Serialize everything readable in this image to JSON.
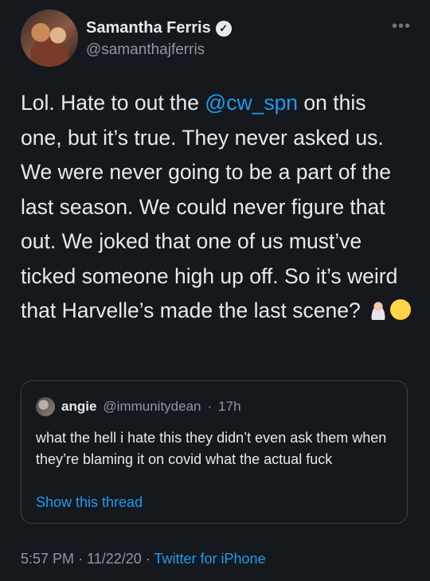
{
  "author": {
    "name": "Samantha Ferris",
    "handle": "@samanthajferris",
    "verified": true
  },
  "more_icon": "more-dots-icon",
  "tweet": {
    "text_before": "Lol. Hate to out the ",
    "mention": "@cw_spn",
    "text_after": " on this one, but it’s true. They never asked us. We were never going to be a part of the last season. We could never figure that out. We joked that one of us must’ve ticked someone high up off. So it’s weird that Harvelle’s made the last scene?",
    "emojis": [
      "person-shrugging-emoji",
      "face-with-monocle-emoji"
    ]
  },
  "quoted_tweet": {
    "name": "angie",
    "handle": "@immunitydean",
    "separator": "·",
    "time": "17h",
    "text": "what the hell i hate this they didn’t even ask them when they’re blaming it on covid what the actual fuck",
    "show_thread": "Show this thread"
  },
  "footer": {
    "time": "5:57 PM",
    "sep1": "·",
    "date": "11/22/20",
    "sep2": "·",
    "source": "Twitter for iPhone"
  },
  "colors": {
    "background": "#15181c",
    "text": "#e7e9ea",
    "secondary": "#8b98a5",
    "link": "#1d9bf0",
    "border": "#38444d"
  }
}
